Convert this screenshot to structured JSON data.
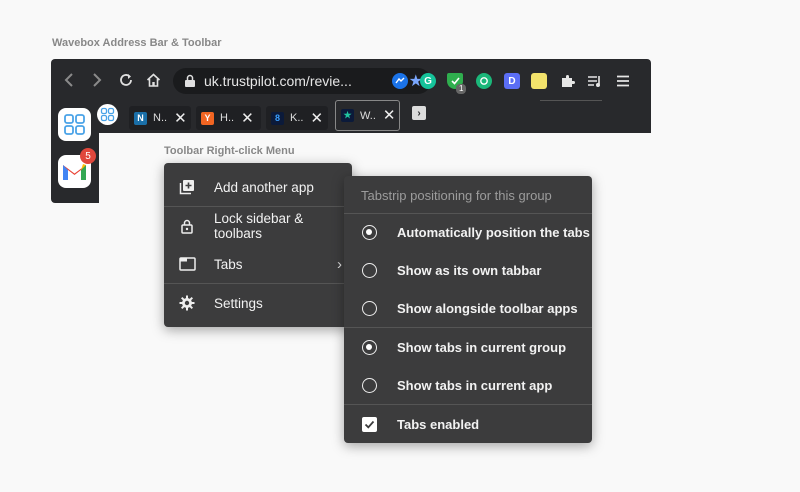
{
  "captions": {
    "address_bar": "Wavebox Address Bar & Toolbar",
    "right_click": "Toolbar Right-click Menu"
  },
  "toolbar": {
    "url": "uk.trustpilot.com/revie...",
    "extension_badge": "1"
  },
  "tabs": [
    {
      "label": "N..",
      "favicon": "N",
      "color": "#1a6fa8"
    },
    {
      "label": "H..",
      "favicon": "Y",
      "color": "#f26522"
    },
    {
      "label": "K..",
      "favicon": "8",
      "color": "#0b1a3a"
    },
    {
      "label": "W..",
      "favicon": "★",
      "color": "#0b1a3a"
    }
  ],
  "sidebar": {
    "gmail_badge": "5"
  },
  "context_menu": {
    "items": [
      {
        "label": "Add another app",
        "icon": "add-app-icon"
      },
      {
        "label": "Lock sidebar & toolbars",
        "icon": "lock-icon"
      },
      {
        "label": "Tabs",
        "icon": "tab-icon"
      },
      {
        "label": "Settings",
        "icon": "gear-icon"
      }
    ]
  },
  "submenu": {
    "heading": "Tabstrip positioning for this group",
    "items": [
      {
        "label": "Automatically position the tabs",
        "checked": true
      },
      {
        "label": "Show as its own tabbar",
        "checked": false
      },
      {
        "label": "Show alongside toolbar apps",
        "checked": false
      },
      {
        "label": "Show tabs in current group",
        "checked": true
      },
      {
        "label": "Show tabs in current app",
        "checked": false
      },
      {
        "label": "Tabs enabled",
        "checked": true
      }
    ]
  }
}
